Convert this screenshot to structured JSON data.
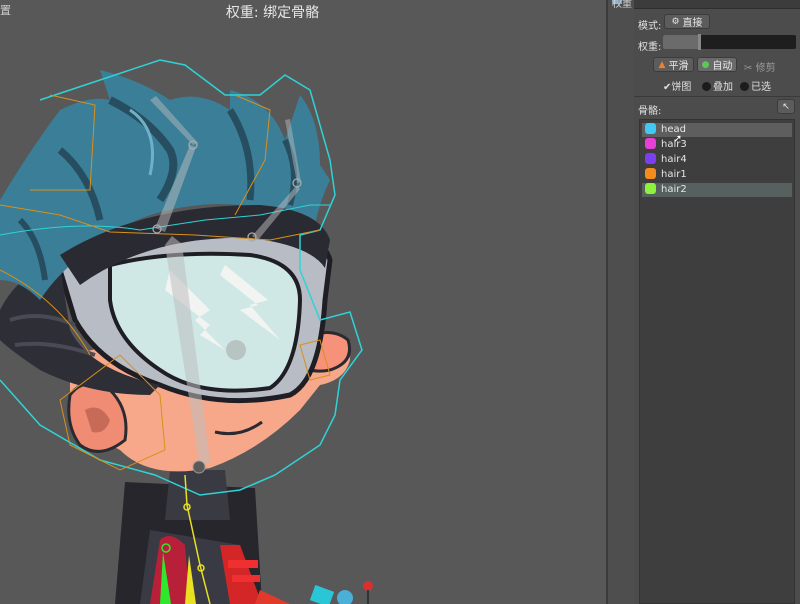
{
  "viewport": {
    "title": "权重: 绑定骨骼",
    "corner_text": "置"
  },
  "panel": {
    "tab_label": "权重",
    "mode_label": "模式:",
    "mode_value": "直接",
    "weight_label": "权重:",
    "weight_value": 0.27,
    "buttons": {
      "smooth": "平滑",
      "auto": "自动",
      "prune": "修剪"
    },
    "checks": {
      "pie": "饼图",
      "overlay": "叠加",
      "selected": "已选"
    },
    "bones_label": "骨骼:",
    "bones": [
      {
        "name": "head",
        "color": "#42c8f4",
        "state": "hover"
      },
      {
        "name": "hair3",
        "color": "#e83fd6",
        "state": "normal"
      },
      {
        "name": "hair4",
        "color": "#7b3ff0",
        "state": "normal"
      },
      {
        "name": "hair1",
        "color": "#f48c1c",
        "state": "normal"
      },
      {
        "name": "hair2",
        "color": "#8ef23c",
        "state": "selected"
      }
    ]
  },
  "colors": {
    "cyan_outline": "#2fd3d6",
    "orange_outline": "#d9901a",
    "bone_green": "#2ee82e",
    "bone_yellow": "#e8e020"
  }
}
